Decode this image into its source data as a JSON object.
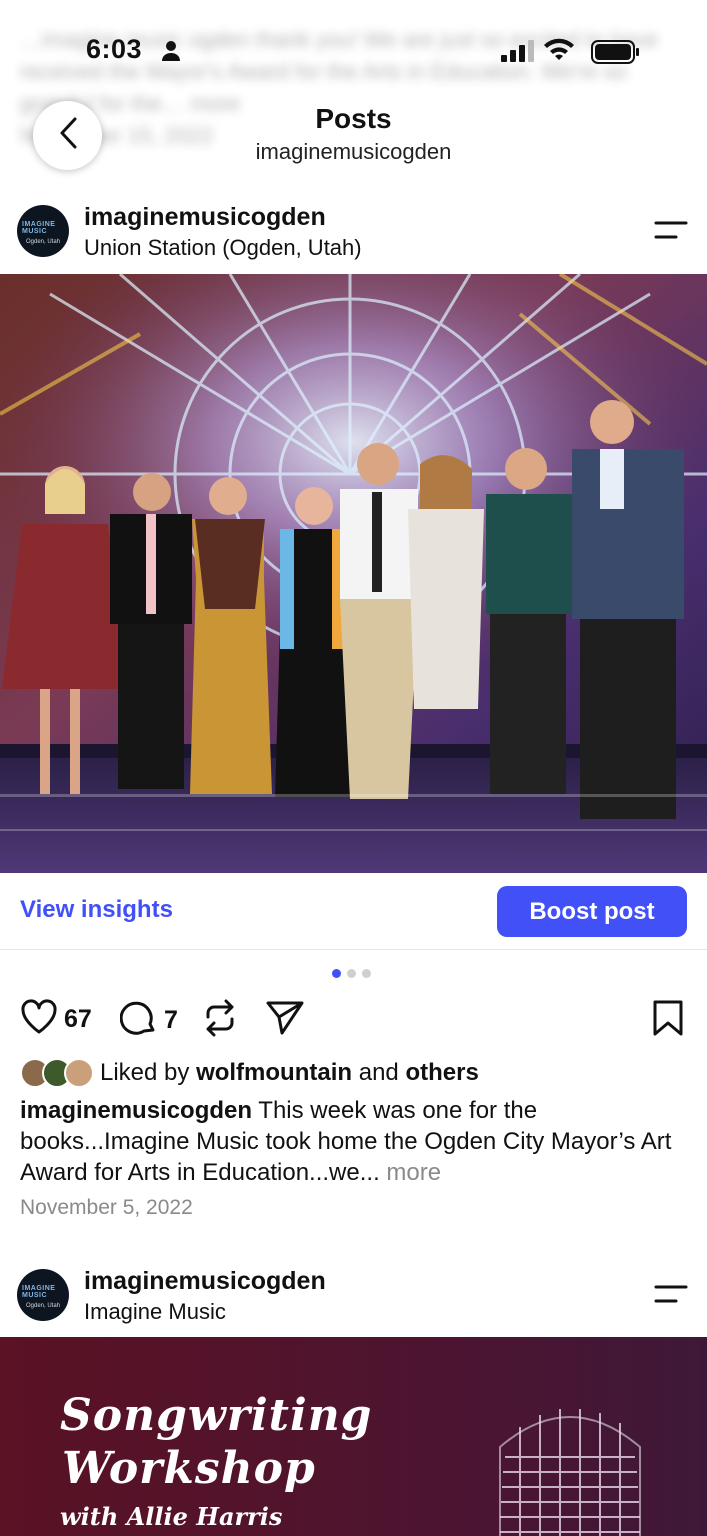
{
  "status_bar": {
    "time": "6:03"
  },
  "background_prev_post": {
    "text": "…imagine music ogden thank you! We are just so excited to have received the Mayor's Award for the Arts in Education. We're so grateful for the… more",
    "date": "November 15, 2022"
  },
  "header": {
    "title": "Posts",
    "subtitle": "imaginemusicogden"
  },
  "post1": {
    "username": "imaginemusicogden",
    "location": "Union Station (Ogden, Utah)",
    "view_insights": "View insights",
    "boost": "Boost post",
    "likes_count": "67",
    "comments_count": "7",
    "liked_by_prefix": "Liked by ",
    "liked_by_user": "wolfmountain",
    "liked_by_and": " and ",
    "liked_by_others": "others",
    "caption_user": "imaginemusicogden",
    "caption_text": " This week was one for the books...Imagine Music took home the Ogden City Mayor’s Art Award for Arts in Education...we... ",
    "caption_more": "more",
    "date": "November 5, 2022",
    "carousel": {
      "count": 3,
      "active": 0
    }
  },
  "post2": {
    "username": "imaginemusicogden",
    "location": "Imagine Music",
    "image_title_line1": "Songwriting",
    "image_title_line2": "Workshop",
    "image_subtitle": "with Allie Harris"
  },
  "avatar_text": {
    "top": "IMAGINE MUSIC",
    "bottom": "Ogden, Utah"
  },
  "colors": {
    "accent": "#4150f7",
    "muted": "#8a8a8a"
  },
  "icons": [
    "person-icon",
    "signal-icon",
    "wifi-icon",
    "battery-icon",
    "back-chevron-icon",
    "menu-lines-icon",
    "heart-icon",
    "comment-icon",
    "repost-icon",
    "send-icon",
    "bookmark-icon"
  ]
}
